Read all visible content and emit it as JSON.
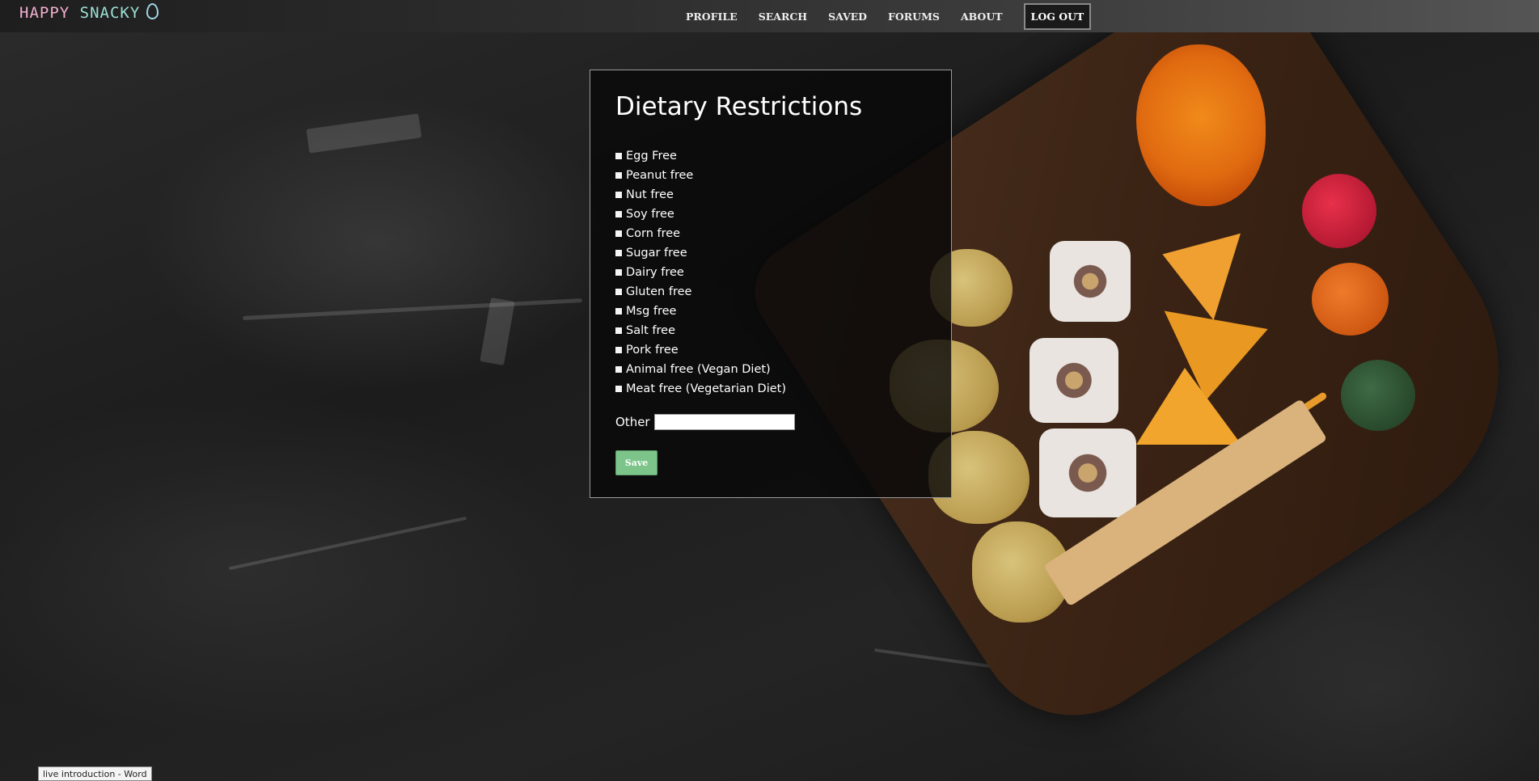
{
  "brand": {
    "logo_part1": "HAPPY ",
    "logo_part2": "SNACKY"
  },
  "nav": {
    "items": [
      "PROFILE",
      "SEARCH",
      "SAVED",
      "FORUMS",
      "ABOUT"
    ],
    "logout_label": "LOG OUT"
  },
  "form": {
    "title": "Dietary Restrictions",
    "options": [
      "Egg Free",
      "Peanut free",
      "Nut free",
      "Soy free",
      "Corn free",
      "Sugar free",
      "Dairy free",
      "Gluten free",
      "Msg free",
      "Salt free",
      "Pork free",
      "Animal free (Vegan Diet)",
      "Meat free (Vegetarian Diet)"
    ],
    "other_label": "Other",
    "other_value": "",
    "save_label": "Save"
  },
  "taskbar": {
    "tooltip": "live introduction - Word"
  },
  "colors": {
    "save_button": "#7cc48a",
    "logo_pink": "#f3b0d0",
    "logo_teal": "#9be0d4"
  }
}
